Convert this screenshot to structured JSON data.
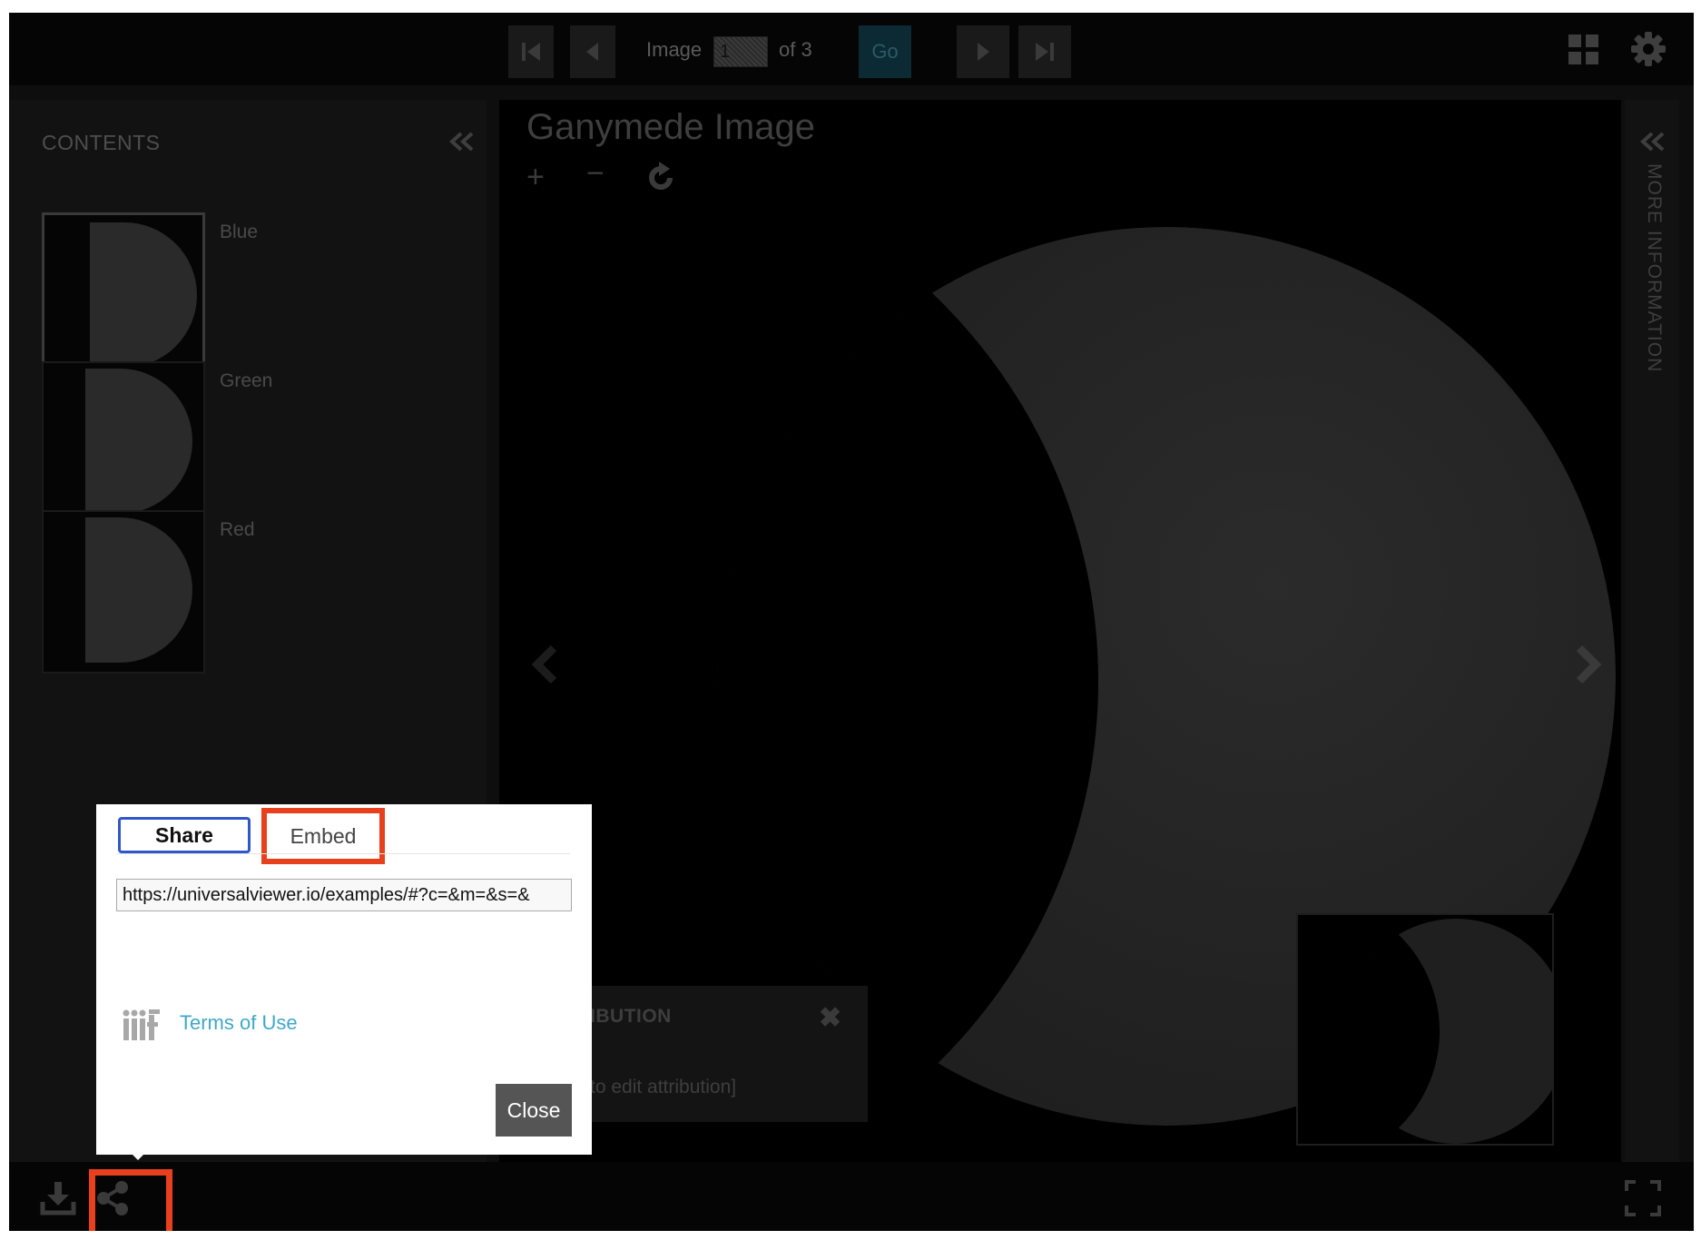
{
  "header": {
    "image_label": "Image",
    "image_input_value": "1",
    "of_label": "of 3",
    "go_label": "Go"
  },
  "left_panel": {
    "title": "CONTENTS",
    "thumbnails": [
      {
        "label": "Blue",
        "selected": true
      },
      {
        "label": "Green",
        "selected": false
      },
      {
        "label": "Red",
        "selected": false
      }
    ]
  },
  "center": {
    "title": "Ganymede Image",
    "zoom_in": "+",
    "zoom_out": "−"
  },
  "attribution": {
    "title": "IBUTION",
    "text": "to edit attribution]",
    "close": "✖"
  },
  "right_panel": {
    "label": "MORE INFORMATION"
  },
  "dialog": {
    "tabs": {
      "share": "Share",
      "embed": "Embed"
    },
    "url": "https://universalviewer.io/examples/#?c=&m=&s=&",
    "terms_label": "Terms of Use",
    "close_label": "Close"
  },
  "colors": {
    "highlight": "#e8401c",
    "share_tab_border": "#2f57c9",
    "link": "#3fa8c8",
    "close_button": "#555555"
  },
  "icons": [
    "first-page-icon",
    "prev-page-icon",
    "next-page-icon",
    "last-page-icon",
    "grid-icon",
    "settings-icon",
    "collapse-icon",
    "rotate-icon",
    "download-icon",
    "share-icon",
    "fullscreen-icon",
    "iiif-logo"
  ]
}
